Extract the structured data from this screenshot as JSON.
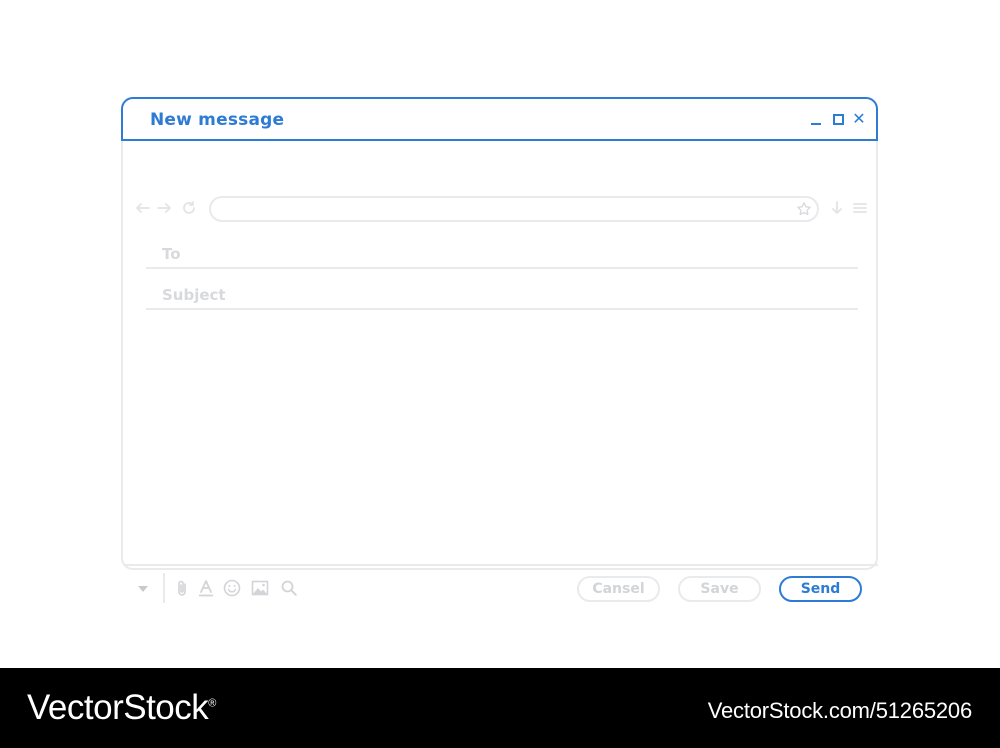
{
  "window": {
    "title": "New message",
    "controls": {
      "minimize_icon": "minimize-icon",
      "maximize_icon": "maximize-icon",
      "close_icon": "close-icon"
    }
  },
  "nav": {
    "icons": [
      "back-arrow-icon",
      "forward-arrow-icon",
      "refresh-icon",
      "star-icon",
      "download-icon",
      "menu-icon"
    ],
    "address_value": ""
  },
  "fields": {
    "to_label": "To",
    "to_value": "",
    "subject_label": "Subject",
    "subject_value": ""
  },
  "message_body": "",
  "toolbar": {
    "icons": [
      "dropdown-icon",
      "attach-icon",
      "text-format-icon",
      "emoji-icon",
      "image-icon",
      "search-icon"
    ],
    "cancel_label": "Cansel",
    "save_label": "Save",
    "send_label": "Send"
  },
  "footer": {
    "brand": "VectorStock",
    "brand_mark": "®",
    "url": "VectorStock.com/51265206"
  },
  "colors": {
    "accent": "#2e7bd6",
    "border_muted": "#e9eaec",
    "text_muted": "#d8d9dc",
    "footer_bg": "#000000"
  }
}
